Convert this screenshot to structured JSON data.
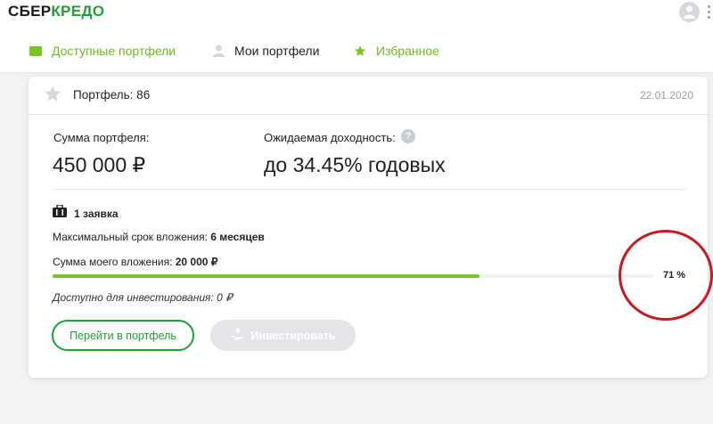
{
  "brand": {
    "part1": "СБЕР",
    "part2": "КРЕДО"
  },
  "tabs": [
    {
      "label": "Доступные портфели",
      "icon": "wallet-icon"
    },
    {
      "label": "Мои портфели",
      "icon": "user-icon"
    },
    {
      "label": "Избранное",
      "icon": "star-icon"
    }
  ],
  "portfolio": {
    "title": "Портфель: 86",
    "date": "22.01.2020",
    "sum_label": "Сумма портфеля:",
    "sum_value": "450 000 ₽",
    "yield_label": "Ожидаемая доходность:",
    "yield_value": "до 34.45% годовых",
    "help": "?",
    "requests": "1 заявка",
    "max_term_label": "Максимальный срок вложения:",
    "max_term_value": "6 месяцев",
    "my_invest_label": "Сумма моего вложения:",
    "my_invest_value": "20 000 ₽",
    "progress_percent": 71,
    "progress_label": "71 %",
    "available": "Доступно для инвестирования: 0 ₽"
  },
  "buttons": {
    "go_to_portfolio": "Перейти в портфель",
    "invest": "Инвестировать"
  },
  "colors": {
    "brand_green": "#21a038",
    "progress_green": "#7ac41f",
    "annotation_red": "#c8171d"
  }
}
